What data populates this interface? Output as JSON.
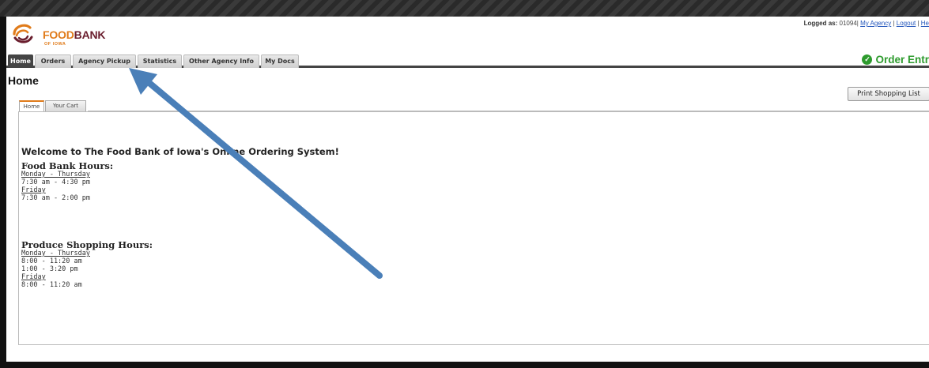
{
  "logo": {
    "word_food": "FOOD",
    "word_bank": "BANK",
    "word_sub": "OF IOWA"
  },
  "header": {
    "logged_label": "Logged as:",
    "logged_id": "01094|",
    "links": [
      "My Agency",
      "Logout",
      "He"
    ]
  },
  "nav": {
    "tabs": [
      "Home",
      "Orders",
      "Agency Pickup",
      "Statistics",
      "Other Agency Info",
      "My Docs"
    ],
    "active": "Home"
  },
  "order_entry": {
    "label": "Order Entr"
  },
  "page": {
    "title": "Home",
    "print_button": "Print Shopping List"
  },
  "subtabs": [
    "Home",
    "Your Cart"
  ],
  "content": {
    "welcome": "Welcome to The Food Bank of Iowa's Online Ordering System!",
    "food_bank_hours": {
      "heading": "Food Bank Hours:",
      "day1": "Monday - Thursday",
      "time1": "7:30 am - 4:30 pm",
      "day2": "Friday",
      "time2": "7:30 am - 2:00 pm"
    },
    "produce_hours": {
      "heading": "Produce Shopping Hours:",
      "day1": "Monday - Thursday",
      "time1a": "8:00 - 11:20 am",
      "time1b": "1:00 - 3:20 pm",
      "day2": "Friday",
      "time2": "8:00 - 11:20 am"
    }
  },
  "colors": {
    "brand_orange": "#e07b1a",
    "brand_maroon": "#6a1e2e",
    "order_green": "#2e9b2e",
    "arrow_blue": "#4a7fb8"
  }
}
